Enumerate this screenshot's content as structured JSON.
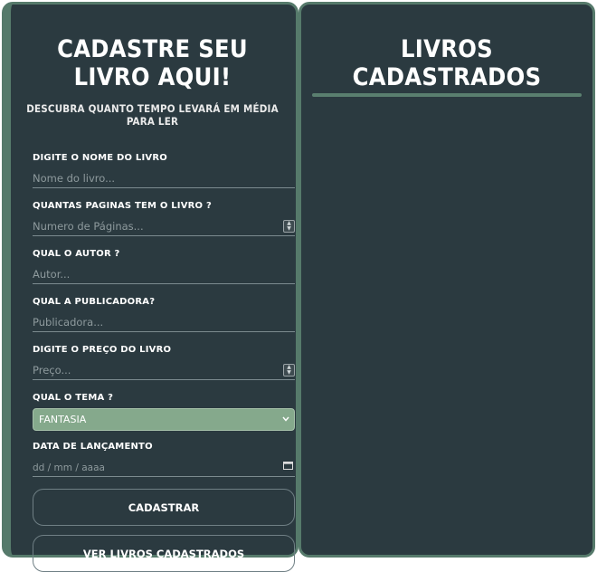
{
  "form": {
    "title": "CADASTRE SEU LIVRO AQUI!",
    "subtitle": "DESCUBRA QUANTO TEMPO LEVARÁ EM MÉDIA PARA LER",
    "fields": [
      {
        "label": "DIGITE O NOME DO LIVRO",
        "placeholder": "Nome do livro..."
      },
      {
        "label": "QUANTAS PAGINAS TEM O LIVRO ?",
        "placeholder": "Numero de Páginas..."
      },
      {
        "label": "QUAL O AUTOR ?",
        "placeholder": "Autor..."
      },
      {
        "label": "QUAL A PUBLICADORA?",
        "placeholder": "Publicadora..."
      },
      {
        "label": "DIGITE O PREÇO DO LIVRO",
        "placeholder": "Preço..."
      }
    ],
    "theme": {
      "label": "QUAL O TEMA ?",
      "selected": "FANTASIA"
    },
    "release_date": {
      "label": "DATA DE LANÇAMENTO",
      "placeholder": "dd / mm / aaaa"
    },
    "submit_label": "CADASTRAR",
    "view_label": "VER LIVROS CADASTRADOS"
  },
  "list": {
    "title": "LIVROS CADASTRADOS"
  },
  "colors": {
    "panel_bg": "#2b3a40",
    "panel_border": "#567a6b",
    "select_bg": "#85a98c"
  }
}
